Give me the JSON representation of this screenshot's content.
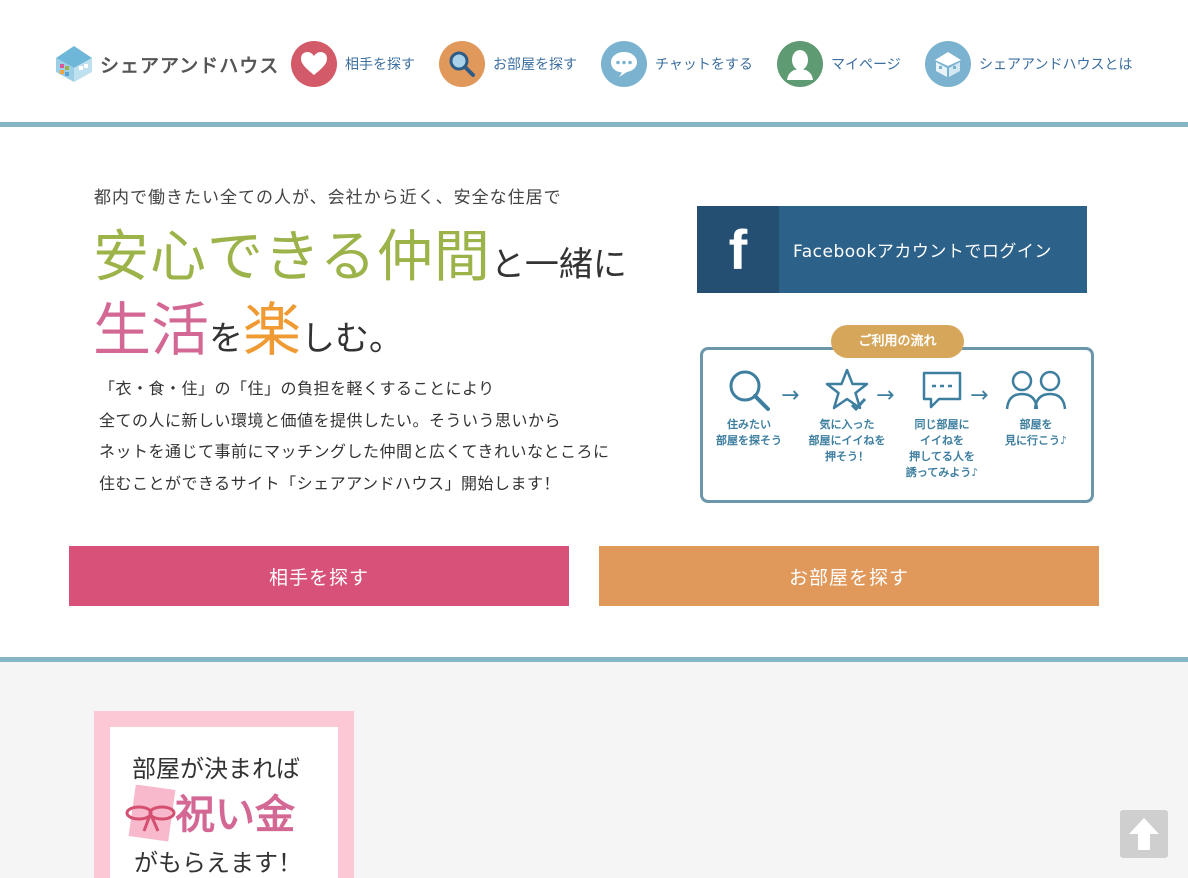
{
  "header": {
    "logo_text": "シェアアンドハウス",
    "nav": [
      {
        "label": "相手を探す",
        "icon": "heart-icon",
        "color": "#d35a69"
      },
      {
        "label": "お部屋を探す",
        "icon": "magnifier-icon",
        "color": "#e0985b"
      },
      {
        "label": "チャットをする",
        "icon": "chat-bubble-icon",
        "color": "#7ab2cf"
      },
      {
        "label": "マイページ",
        "icon": "person-icon",
        "color": "#5e9a72"
      },
      {
        "label": "シェアアンドハウスとは",
        "icon": "house-icon",
        "color": "#7ab2cf"
      }
    ]
  },
  "hero": {
    "lead": "都内で働きたい全ての人が、会社から近く、安全な住居で",
    "headline1_big": "安心できる仲間",
    "headline1_small": "と一緒に",
    "headline2_pink": "生活",
    "headline2_small1": "を",
    "headline2_orange": "楽",
    "headline2_small2": "しむ。",
    "description": [
      "「衣・食・住」の「住」の負担を軽くすることにより",
      "全ての人に新しい環境と価値を提供したい。そういう思いから",
      "ネットを通じて事前にマッチングした仲間と広くてきれいなところに",
      "住むことができるサイト「シェアアンドハウス」開始します！"
    ]
  },
  "facebook": {
    "icon_letter": "f",
    "label": "Facebookアカウントでログイン",
    "color": "#2c6189"
  },
  "flow": {
    "title": "ご利用の流れ",
    "steps": [
      {
        "icon": "search-icon",
        "lines": [
          "住みたい",
          "部屋を探そう"
        ]
      },
      {
        "icon": "star-check-icon",
        "lines": [
          "気に入った",
          "部屋にイイねを",
          "押そう！"
        ]
      },
      {
        "icon": "chat-icon",
        "lines": [
          "同じ部屋に",
          "イイねを",
          "押してる人を",
          "誘ってみよう♪"
        ]
      },
      {
        "icon": "people-icon",
        "lines": [
          "部屋を",
          "見に行こう♪"
        ]
      }
    ],
    "arrow": "→"
  },
  "cta": {
    "partner_label": "相手を探す",
    "room_label": "お部屋を探す",
    "partner_color": "#d75179",
    "room_color": "#e0985b"
  },
  "banner": {
    "line1": "部屋が決まれば",
    "line2": "祝い金",
    "line3": "がもらえます！"
  },
  "scroll_top": {
    "icon": "arrow-up-icon"
  }
}
